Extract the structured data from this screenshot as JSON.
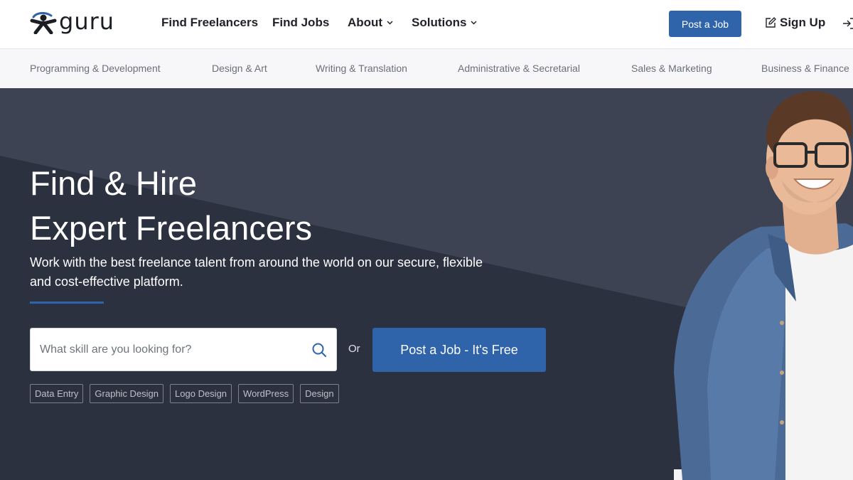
{
  "brand": {
    "name": "guru"
  },
  "nav": {
    "links": [
      {
        "label": "Find Freelancers"
      },
      {
        "label": "Find Jobs"
      },
      {
        "label": "About"
      },
      {
        "label": "Solutions"
      }
    ],
    "post_job_label": "Post a Job",
    "signup_label": "Sign Up"
  },
  "categories": [
    "Programming & Development",
    "Design & Art",
    "Writing & Translation",
    "Administrative & Secretarial",
    "Sales & Marketing",
    "Business & Finance"
  ],
  "hero": {
    "title_line1": "Find & Hire",
    "title_line2": "Expert Freelancers",
    "subtitle": "Work with the best freelance talent from around the world on our secure, flexible and cost-effective platform.",
    "search_placeholder": "What skill are you looking for?",
    "or_text": "Or",
    "cta_label": "Post a Job - It's Free",
    "tags": [
      "Data Entry",
      "Graphic Design",
      "Logo Design",
      "WordPress",
      "Design"
    ]
  },
  "colors": {
    "brand_blue": "#2f64ab",
    "hero_dark": "#333847",
    "hero_light": "#3d4353"
  },
  "icons": [
    "guru-logo-icon",
    "chevron-down-icon",
    "edit-icon",
    "login-icon",
    "search-icon"
  ]
}
